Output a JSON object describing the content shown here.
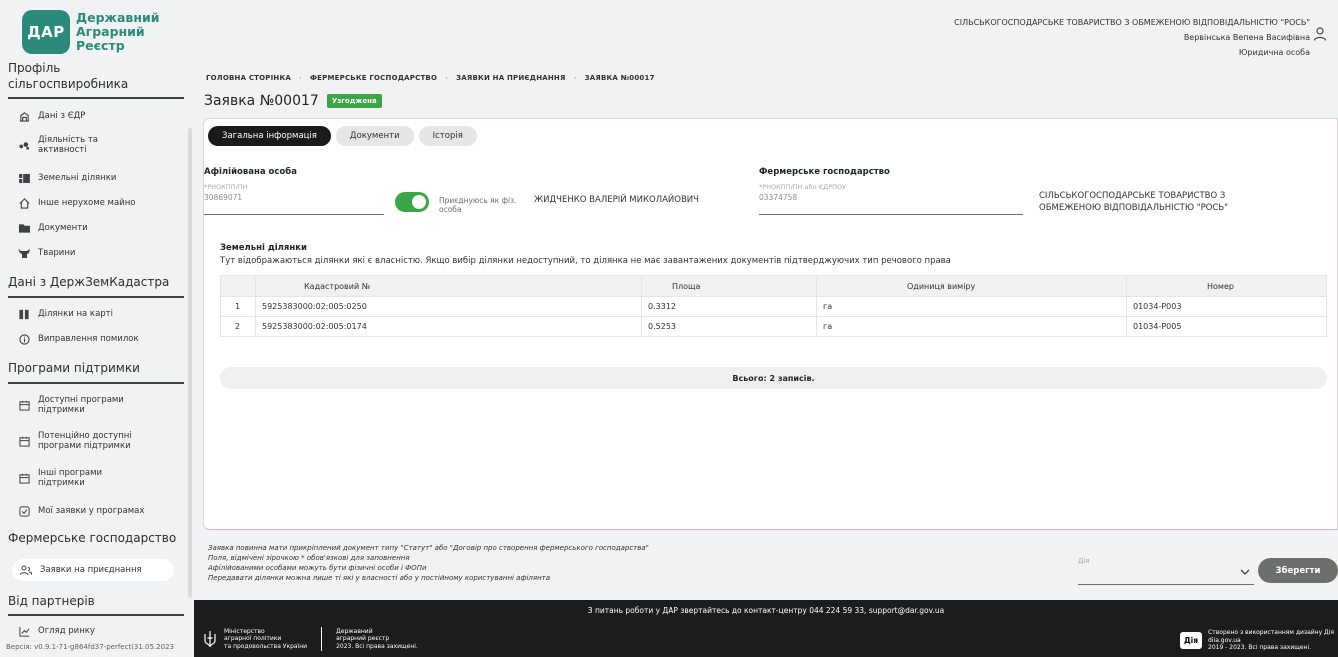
{
  "logo": {
    "badge": "ДАР",
    "line1": "Державний",
    "line2": "Аграрний",
    "line3": "Реєстр"
  },
  "sidebar": {
    "profile_title": "Профіль сільгоспвиробника",
    "profile_items": [
      {
        "label": "Дані з ЄДР",
        "icon": "building-icon"
      },
      {
        "label": "Діяльність та активності",
        "icon": "activity-icon"
      },
      {
        "label": "Земельні ділянки",
        "icon": "land-icon"
      },
      {
        "label": "Інше нерухоме майно",
        "icon": "house-icon"
      },
      {
        "label": "Документи",
        "icon": "folder-icon"
      },
      {
        "label": "Тварини",
        "icon": "animal-icon"
      }
    ],
    "cadastre_title": "Дані з ДержЗемКадастра",
    "cadastre_items": [
      {
        "label": "Ділянки на карті",
        "icon": "map-icon"
      },
      {
        "label": "Виправлення помилок",
        "icon": "info-icon"
      }
    ],
    "support_title": "Програми підтримки",
    "support_items": [
      {
        "label": "Доступні програми підтримки",
        "icon": "calendar-icon"
      },
      {
        "label": "Потенційно доступні програми підтримки",
        "icon": "calendar-icon"
      },
      {
        "label": "Інші програми підтримки",
        "icon": "calendar-icon"
      },
      {
        "label": "Мої заявки у програмах",
        "icon": "checkbox-icon"
      }
    ],
    "farm_title": "Фермерське господарство",
    "farm_items": [
      {
        "label": "Заявки на приєднання",
        "icon": "users-icon"
      }
    ],
    "partners_title": "Від партнерів",
    "partners_items": [
      {
        "label": "Огляд ринку",
        "icon": "chart-icon"
      }
    ],
    "version": "Версія: v0.9.1-71-g864fd37-perfect(31.05.2023"
  },
  "header": {
    "org_name": "СІЛЬСЬКОГОСПОДАРСЬКЕ ТОВАРИСТВО З ОБМЕЖЕНОЮ ВІДПОВІДАЛЬНІСТЮ \"РОСЬ\"",
    "user_name": "Вервінська Вепена Васифівна",
    "user_role": "Юридична особа"
  },
  "breadcrumb": [
    "ГОЛОВНА СТОРІНКА",
    "ФЕРМЕРСЬКЕ ГОСПОДАРСТВО",
    "ЗАЯВКИ НА ПРИЄДНАННЯ",
    "ЗАЯВКА №00017"
  ],
  "page": {
    "title": "Заявка №00017",
    "status": "Узгоджена"
  },
  "tabs": [
    "Загальна інформація",
    "Документи",
    "Історія"
  ],
  "affiliate": {
    "heading": "Афілійована особа",
    "placeholder": "*РНОКПП/ПН",
    "value": "30869071",
    "toggle_label": "Приєднуюсь як фіз. особа",
    "toggle_on": true,
    "name": "ЖИДЧЕНКО ВАЛЕРІЙ МИКОЛАЙОВИЧ"
  },
  "farm": {
    "heading": "Фермерське господарство",
    "placeholder": "*РНОКПП/ПН або ЄДРПОУ",
    "value": "03374758",
    "name_line1": "СІЛЬСЬКОГОСПОДАРСЬКЕ ТОВАРИСТВО З",
    "name_line2": "ОБМЕЖЕНОЮ ВІДПОВІДАЛЬНІСТЮ \"РОСЬ\""
  },
  "plots": {
    "title": "Земельні ділянки",
    "description": "Тут відображаються ділянки які є власністю. Якщо вибір ділянки недоступний, то ділянка не має завантажених документів підтверджуючих тип речового права",
    "columns": [
      "Кадастровий №",
      "Площа",
      "Одиниця виміру",
      "Номер"
    ],
    "rows": [
      {
        "n": "1",
        "cadastral": "5925383000:02:005:0250",
        "area": "0.3312",
        "unit": "га",
        "number": "01034-P003"
      },
      {
        "n": "2",
        "cadastral": "5925383000:02:005:0174",
        "area": "0.5253",
        "unit": "га",
        "number": "01034-P005"
      }
    ],
    "total": "Всього: 2 записів."
  },
  "notes": [
    "Заявка повинна мати прикріплений документ типу \"Статут\" або \"Договір про створення фермерського господарства\"",
    "Поля, відмічені зірочкою * обов'язкові для заповнення",
    "Афілійованими особами можуть бути фізичні особи і ФОПи",
    "Передавати ділянки можна лише ті які у власності або у постійному користуванні афілянта"
  ],
  "actions": {
    "select_placeholder": "Дія",
    "save_label": "Зберегти"
  },
  "footer": {
    "contact": "З питань роботи у ДАР звертайтесь до контакт-центру 044 224 59 33, support@dar.gov.ua",
    "ministry_1": "Міністерство",
    "ministry_2": "аграрної політики",
    "ministry_3": "та продовольства України",
    "registry_1": "Державний",
    "registry_2": "аграрний реєстр",
    "registry_3": "2023. Всі права захищені.",
    "diia_badge": "Дія",
    "diia_1": "Створено з використанням дизайну Дія",
    "diia_2": "diia.gov.ua",
    "diia_3": "2019 - 2023. Всі права захищені."
  },
  "colors": {
    "brand": "#2c8a7a",
    "status_green": "#3aa646",
    "footer_bg": "#1c1c1c"
  }
}
